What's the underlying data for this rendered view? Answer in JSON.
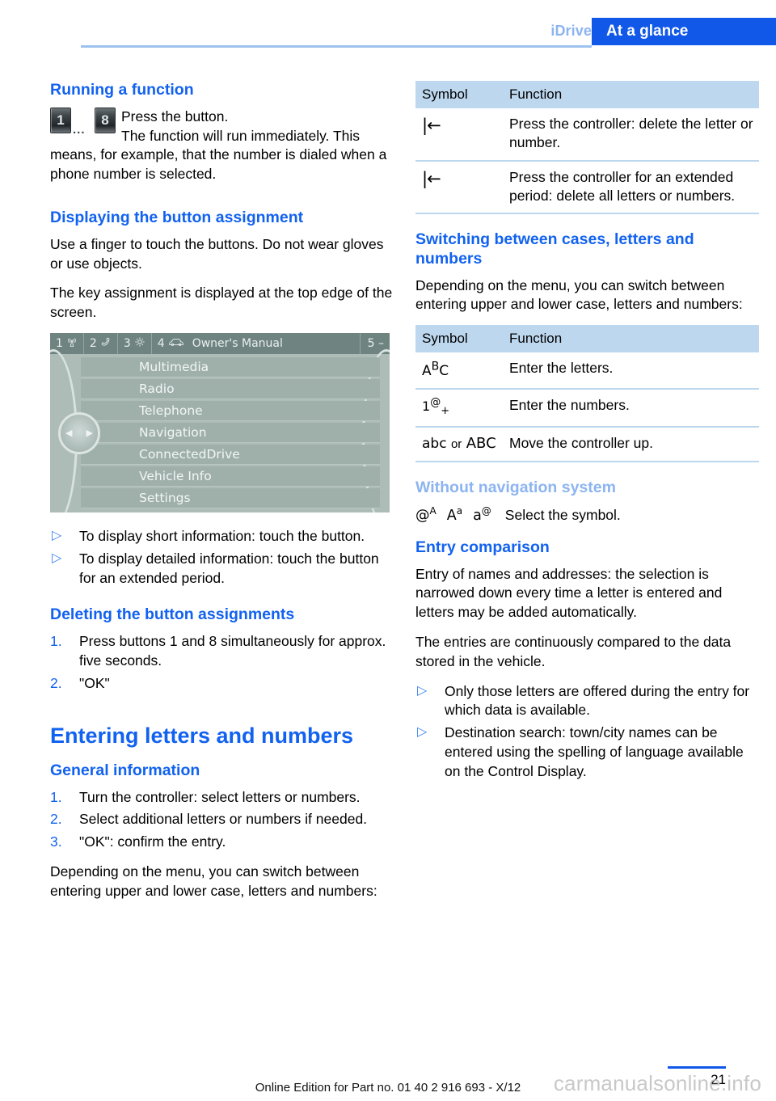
{
  "header": {
    "tab_muted": "iDrive",
    "tab_active": "At a glance"
  },
  "left": {
    "sec_running": "Running a function",
    "keys": {
      "first": "1",
      "dots": "...",
      "last": "8"
    },
    "running_p1": "Press the button.",
    "running_p2": "The function will run immediately. This means, for example, that the number is dialed when a phone number is selected.",
    "sec_displaying": "Displaying the button assignment",
    "displaying_p1": "Use a finger to touch the buttons. Do not wear gloves or use objects.",
    "displaying_p2": "The key assignment is displayed at the top edge of the screen.",
    "idrive": {
      "bar": [
        {
          "num": "1",
          "icon": "broadcast-antenna-icon",
          "glyph": "((\u0001))"
        },
        {
          "num": "2",
          "icon": "telephone-handset-icon",
          "glyph": "☎"
        },
        {
          "num": "3",
          "icon": "gear-icon",
          "glyph": "⚙"
        },
        {
          "num": "4",
          "icon": "car-icon",
          "glyph": "🚗"
        }
      ],
      "title": "Owner's Manual",
      "right_label": "5 –",
      "menu": [
        "Multimedia",
        "Radio",
        "Telephone",
        "Navigation",
        "ConnectedDrive",
        "Vehicle Info",
        "Settings"
      ]
    },
    "bullets_touch": [
      "To display short information: touch the button.",
      "To display detailed information: touch the button for an extended period."
    ],
    "sec_deleting": "Deleting the button assignments",
    "deleting_steps": [
      "Press buttons 1 and 8 simultaneously for approx. five seconds.",
      "\"OK\""
    ],
    "chap_entering": "Entering letters and numbers",
    "sec_general": "General information",
    "general_steps": [
      "Turn the controller: select letters or numbers.",
      "Select additional letters or numbers if needed.",
      "\"OK\": confirm the entry."
    ],
    "general_p": "Depending on the menu, you can switch between entering upper and lower case, letters and numbers:"
  },
  "right": {
    "table_delete": {
      "headers": [
        "Symbol",
        "Function"
      ],
      "rows": [
        {
          "symbol": "|←",
          "symbol_name": "backspace-icon",
          "function": "Press the controller: delete the letter or number."
        },
        {
          "symbol": "|←",
          "symbol_name": "backspace-icon",
          "function": "Press the controller for an extended period: delete all letters or numbers."
        }
      ]
    },
    "sec_switching": "Switching between cases, letters and numbers",
    "switching_p": "Depending on the menu, you can switch between entering upper and lower case, letters and numbers:",
    "table_case": {
      "headers": [
        "Symbol",
        "Function"
      ],
      "rows": [
        {
          "symbol": "ABC",
          "symbol_name": "abc-uppercase-icon",
          "function": "Enter the letters."
        },
        {
          "symbol": "1@+",
          "symbol_name": "numbers-symbols-icon",
          "function": "Enter the numbers."
        },
        {
          "symbol": "abc or ABC",
          "symbol_name": "case-toggle-icon",
          "function": "Move the controller up."
        }
      ]
    },
    "sec_without_nav": "Without navigation system",
    "without_nav_symbols": [
      "@ᴬ",
      "Aᵃ",
      "a@"
    ],
    "without_nav_text": "Select the symbol.",
    "sec_entry_comparison": "Entry comparison",
    "entry_p1": "Entry of names and addresses: the selection is narrowed down every time a letter is entered and letters may be added automatically.",
    "entry_p2": "The entries are continuously compared to the data stored in the vehicle.",
    "entry_bullets": [
      "Only those letters are offered during the entry for which data is available.",
      "Destination search: town/city names can be entered using the spelling of language available on the Control Display."
    ]
  },
  "footer": {
    "edition": "Online Edition for Part no. 01 40 2 916 693 - X/12",
    "page": "21",
    "watermark": "carmanualsonline.info"
  },
  "colors": {
    "accent_blue": "#1262f0",
    "tab_blue": "#1158e8",
    "muted_blue": "#8cb4f0",
    "table_header": "#bdd7ef"
  }
}
